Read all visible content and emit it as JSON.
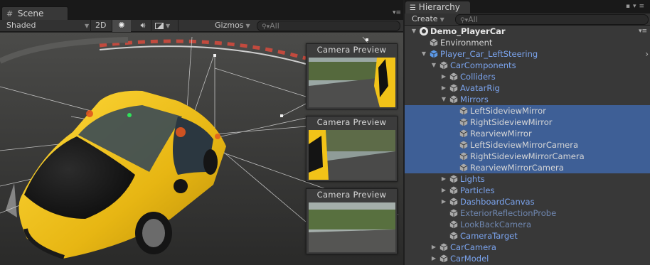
{
  "scene": {
    "tab_label": "Scene",
    "tab_icon": "hash-grid-icon",
    "toolbar": {
      "shading_mode": "Shaded",
      "mode_2d": "2D",
      "gizmos_label": "Gizmos",
      "search_placeholder": "All"
    },
    "camera_previews": [
      {
        "title": "Camera Preview"
      },
      {
        "title": "Camera Preview"
      },
      {
        "title": "Camera Preview"
      }
    ]
  },
  "hierarchy": {
    "tab_label": "Hierarchy",
    "create_label": "Create",
    "search_placeholder": "All",
    "items": [
      {
        "label": "Demo_PlayerCar",
        "depth": 0,
        "expanded": true,
        "kind": "scene",
        "selected": false,
        "style": "bold"
      },
      {
        "label": "Environment",
        "depth": 1,
        "expanded": null,
        "kind": "object",
        "selected": false,
        "style": "white"
      },
      {
        "label": "Player_Car_LeftSteering",
        "depth": 1,
        "expanded": true,
        "kind": "prefab",
        "selected": false,
        "style": "blue"
      },
      {
        "label": "CarComponents",
        "depth": 2,
        "expanded": true,
        "kind": "object",
        "selected": false,
        "style": "blue"
      },
      {
        "label": "Colliders",
        "depth": 3,
        "expanded": false,
        "kind": "object",
        "selected": false,
        "style": "blue"
      },
      {
        "label": "AvatarRig",
        "depth": 3,
        "expanded": false,
        "kind": "object",
        "selected": false,
        "style": "blue"
      },
      {
        "label": "Mirrors",
        "depth": 3,
        "expanded": true,
        "kind": "object",
        "selected": false,
        "style": "blue"
      },
      {
        "label": "LeftSideviewMirror",
        "depth": 4,
        "expanded": null,
        "kind": "object",
        "selected": true,
        "style": "white"
      },
      {
        "label": "RightSideviewMirror",
        "depth": 4,
        "expanded": null,
        "kind": "object",
        "selected": true,
        "style": "white"
      },
      {
        "label": "RearviewMirror",
        "depth": 4,
        "expanded": null,
        "kind": "object",
        "selected": true,
        "style": "white"
      },
      {
        "label": "LeftSideviewMirrorCamera",
        "depth": 4,
        "expanded": null,
        "kind": "object",
        "selected": true,
        "style": "white"
      },
      {
        "label": "RightSideviewMirrorCamera",
        "depth": 4,
        "expanded": null,
        "kind": "object",
        "selected": true,
        "style": "white"
      },
      {
        "label": "RearviewMirrorCamera",
        "depth": 4,
        "expanded": null,
        "kind": "object",
        "selected": true,
        "style": "white"
      },
      {
        "label": "Lights",
        "depth": 3,
        "expanded": false,
        "kind": "object",
        "selected": false,
        "style": "blue"
      },
      {
        "label": "Particles",
        "depth": 3,
        "expanded": false,
        "kind": "object",
        "selected": false,
        "style": "blue"
      },
      {
        "label": "DashboardCanvas",
        "depth": 3,
        "expanded": false,
        "kind": "object",
        "selected": false,
        "style": "blue"
      },
      {
        "label": "ExteriorReflectionProbe",
        "depth": 3,
        "expanded": null,
        "kind": "object",
        "selected": false,
        "style": "dim"
      },
      {
        "label": "LookBackCamera",
        "depth": 3,
        "expanded": null,
        "kind": "object",
        "selected": false,
        "style": "dim"
      },
      {
        "label": "CameraTarget",
        "depth": 3,
        "expanded": null,
        "kind": "object",
        "selected": false,
        "style": "blue"
      },
      {
        "label": "CarCamera",
        "depth": 2,
        "expanded": false,
        "kind": "object",
        "selected": false,
        "style": "blue"
      },
      {
        "label": "CarModel",
        "depth": 2,
        "expanded": false,
        "kind": "object",
        "selected": false,
        "style": "blue"
      }
    ]
  },
  "colors": {
    "selection": "#3e5f96",
    "prefab_text": "#7ba4ee",
    "car_paint": "#f2c318"
  }
}
